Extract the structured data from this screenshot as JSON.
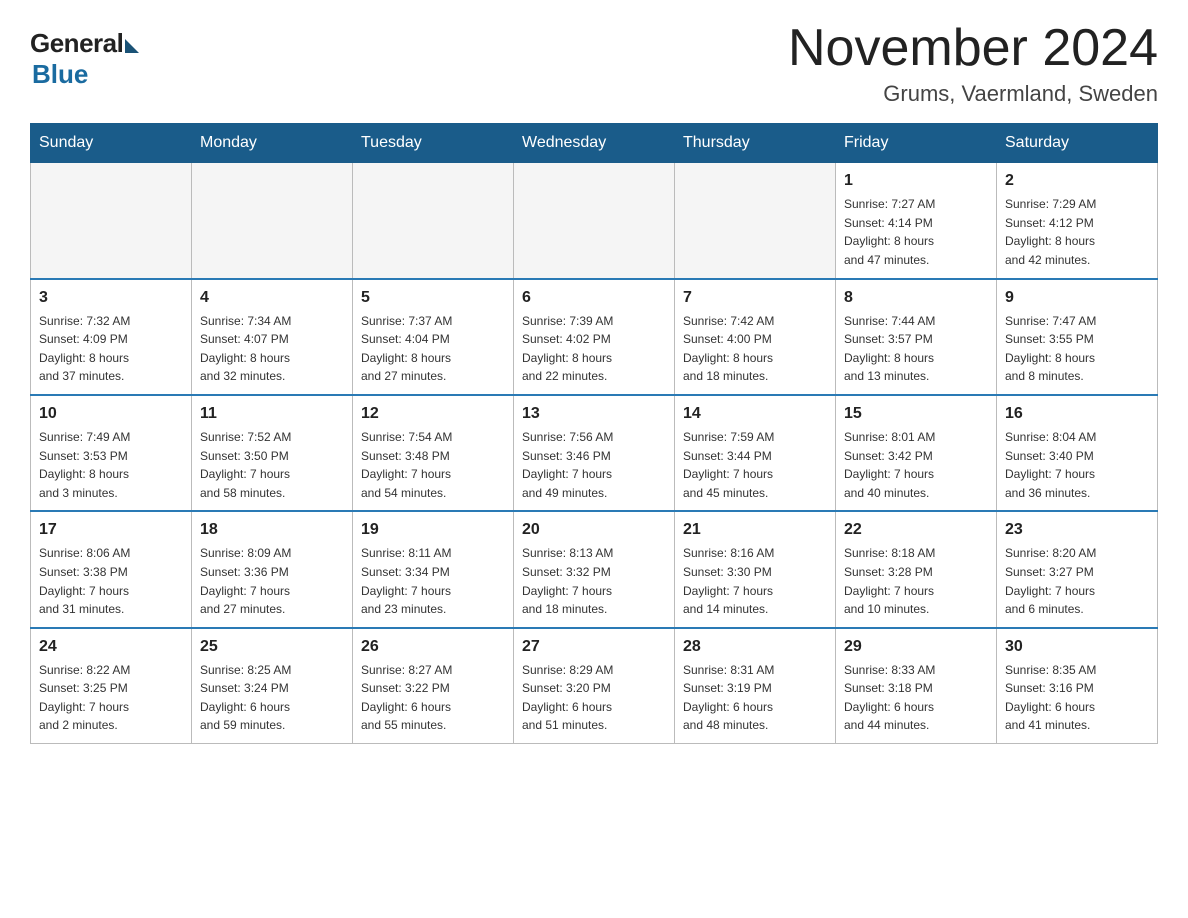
{
  "logo": {
    "general": "General",
    "blue": "Blue"
  },
  "header": {
    "title": "November 2024",
    "location": "Grums, Vaermland, Sweden"
  },
  "weekdays": [
    "Sunday",
    "Monday",
    "Tuesday",
    "Wednesday",
    "Thursday",
    "Friday",
    "Saturday"
  ],
  "weeks": [
    [
      {
        "day": "",
        "info": ""
      },
      {
        "day": "",
        "info": ""
      },
      {
        "day": "",
        "info": ""
      },
      {
        "day": "",
        "info": ""
      },
      {
        "day": "",
        "info": ""
      },
      {
        "day": "1",
        "info": "Sunrise: 7:27 AM\nSunset: 4:14 PM\nDaylight: 8 hours\nand 47 minutes."
      },
      {
        "day": "2",
        "info": "Sunrise: 7:29 AM\nSunset: 4:12 PM\nDaylight: 8 hours\nand 42 minutes."
      }
    ],
    [
      {
        "day": "3",
        "info": "Sunrise: 7:32 AM\nSunset: 4:09 PM\nDaylight: 8 hours\nand 37 minutes."
      },
      {
        "day": "4",
        "info": "Sunrise: 7:34 AM\nSunset: 4:07 PM\nDaylight: 8 hours\nand 32 minutes."
      },
      {
        "day": "5",
        "info": "Sunrise: 7:37 AM\nSunset: 4:04 PM\nDaylight: 8 hours\nand 27 minutes."
      },
      {
        "day": "6",
        "info": "Sunrise: 7:39 AM\nSunset: 4:02 PM\nDaylight: 8 hours\nand 22 minutes."
      },
      {
        "day": "7",
        "info": "Sunrise: 7:42 AM\nSunset: 4:00 PM\nDaylight: 8 hours\nand 18 minutes."
      },
      {
        "day": "8",
        "info": "Sunrise: 7:44 AM\nSunset: 3:57 PM\nDaylight: 8 hours\nand 13 minutes."
      },
      {
        "day": "9",
        "info": "Sunrise: 7:47 AM\nSunset: 3:55 PM\nDaylight: 8 hours\nand 8 minutes."
      }
    ],
    [
      {
        "day": "10",
        "info": "Sunrise: 7:49 AM\nSunset: 3:53 PM\nDaylight: 8 hours\nand 3 minutes."
      },
      {
        "day": "11",
        "info": "Sunrise: 7:52 AM\nSunset: 3:50 PM\nDaylight: 7 hours\nand 58 minutes."
      },
      {
        "day": "12",
        "info": "Sunrise: 7:54 AM\nSunset: 3:48 PM\nDaylight: 7 hours\nand 54 minutes."
      },
      {
        "day": "13",
        "info": "Sunrise: 7:56 AM\nSunset: 3:46 PM\nDaylight: 7 hours\nand 49 minutes."
      },
      {
        "day": "14",
        "info": "Sunrise: 7:59 AM\nSunset: 3:44 PM\nDaylight: 7 hours\nand 45 minutes."
      },
      {
        "day": "15",
        "info": "Sunrise: 8:01 AM\nSunset: 3:42 PM\nDaylight: 7 hours\nand 40 minutes."
      },
      {
        "day": "16",
        "info": "Sunrise: 8:04 AM\nSunset: 3:40 PM\nDaylight: 7 hours\nand 36 minutes."
      }
    ],
    [
      {
        "day": "17",
        "info": "Sunrise: 8:06 AM\nSunset: 3:38 PM\nDaylight: 7 hours\nand 31 minutes."
      },
      {
        "day": "18",
        "info": "Sunrise: 8:09 AM\nSunset: 3:36 PM\nDaylight: 7 hours\nand 27 minutes."
      },
      {
        "day": "19",
        "info": "Sunrise: 8:11 AM\nSunset: 3:34 PM\nDaylight: 7 hours\nand 23 minutes."
      },
      {
        "day": "20",
        "info": "Sunrise: 8:13 AM\nSunset: 3:32 PM\nDaylight: 7 hours\nand 18 minutes."
      },
      {
        "day": "21",
        "info": "Sunrise: 8:16 AM\nSunset: 3:30 PM\nDaylight: 7 hours\nand 14 minutes."
      },
      {
        "day": "22",
        "info": "Sunrise: 8:18 AM\nSunset: 3:28 PM\nDaylight: 7 hours\nand 10 minutes."
      },
      {
        "day": "23",
        "info": "Sunrise: 8:20 AM\nSunset: 3:27 PM\nDaylight: 7 hours\nand 6 minutes."
      }
    ],
    [
      {
        "day": "24",
        "info": "Sunrise: 8:22 AM\nSunset: 3:25 PM\nDaylight: 7 hours\nand 2 minutes."
      },
      {
        "day": "25",
        "info": "Sunrise: 8:25 AM\nSunset: 3:24 PM\nDaylight: 6 hours\nand 59 minutes."
      },
      {
        "day": "26",
        "info": "Sunrise: 8:27 AM\nSunset: 3:22 PM\nDaylight: 6 hours\nand 55 minutes."
      },
      {
        "day": "27",
        "info": "Sunrise: 8:29 AM\nSunset: 3:20 PM\nDaylight: 6 hours\nand 51 minutes."
      },
      {
        "day": "28",
        "info": "Sunrise: 8:31 AM\nSunset: 3:19 PM\nDaylight: 6 hours\nand 48 minutes."
      },
      {
        "day": "29",
        "info": "Sunrise: 8:33 AM\nSunset: 3:18 PM\nDaylight: 6 hours\nand 44 minutes."
      },
      {
        "day": "30",
        "info": "Sunrise: 8:35 AM\nSunset: 3:16 PM\nDaylight: 6 hours\nand 41 minutes."
      }
    ]
  ]
}
